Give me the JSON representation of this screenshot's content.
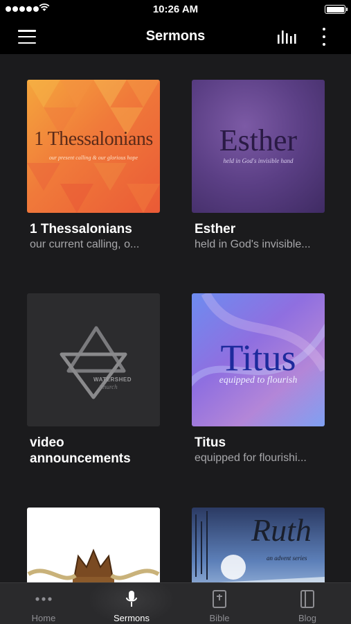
{
  "status_bar": {
    "time": "10:26 AM"
  },
  "app_bar": {
    "title": "Sermons"
  },
  "series": [
    {
      "name": "1 Thessalonians",
      "subtitle": "our current calling, o...",
      "art_title": "1 Thessalonians",
      "art_tagline": "our present calling & our glorious hope"
    },
    {
      "name": "Esther",
      "subtitle": "held in God's invisible...",
      "art_title": "Esther",
      "art_tagline": "held in God's invisible hand"
    },
    {
      "name": "video announcements",
      "subtitle": "",
      "art_title": "WATERSHED",
      "art_tagline": "Church"
    },
    {
      "name": "Titus",
      "subtitle": "equipped for flourishi...",
      "art_title": "Titus",
      "art_tagline": "equipped to flourish"
    },
    {
      "name": "",
      "subtitle": "",
      "art_title": "",
      "art_tagline": ""
    },
    {
      "name": "",
      "subtitle": "",
      "art_title": "Ruth",
      "art_tagline": "an advent series"
    }
  ],
  "tabs": [
    {
      "label": "Home",
      "icon": "ellipsis-icon",
      "active": false
    },
    {
      "label": "Sermons",
      "icon": "microphone-icon",
      "active": true
    },
    {
      "label": "Bible",
      "icon": "bible-icon",
      "active": false
    },
    {
      "label": "Blog",
      "icon": "blog-icon",
      "active": false
    }
  ],
  "colors": {
    "background": "#1b1b1d",
    "bar": "#000000",
    "tab_bar": "#2a2a2c",
    "subtitle": "#a7a7aa",
    "inactive_tab": "#8e8e93"
  }
}
